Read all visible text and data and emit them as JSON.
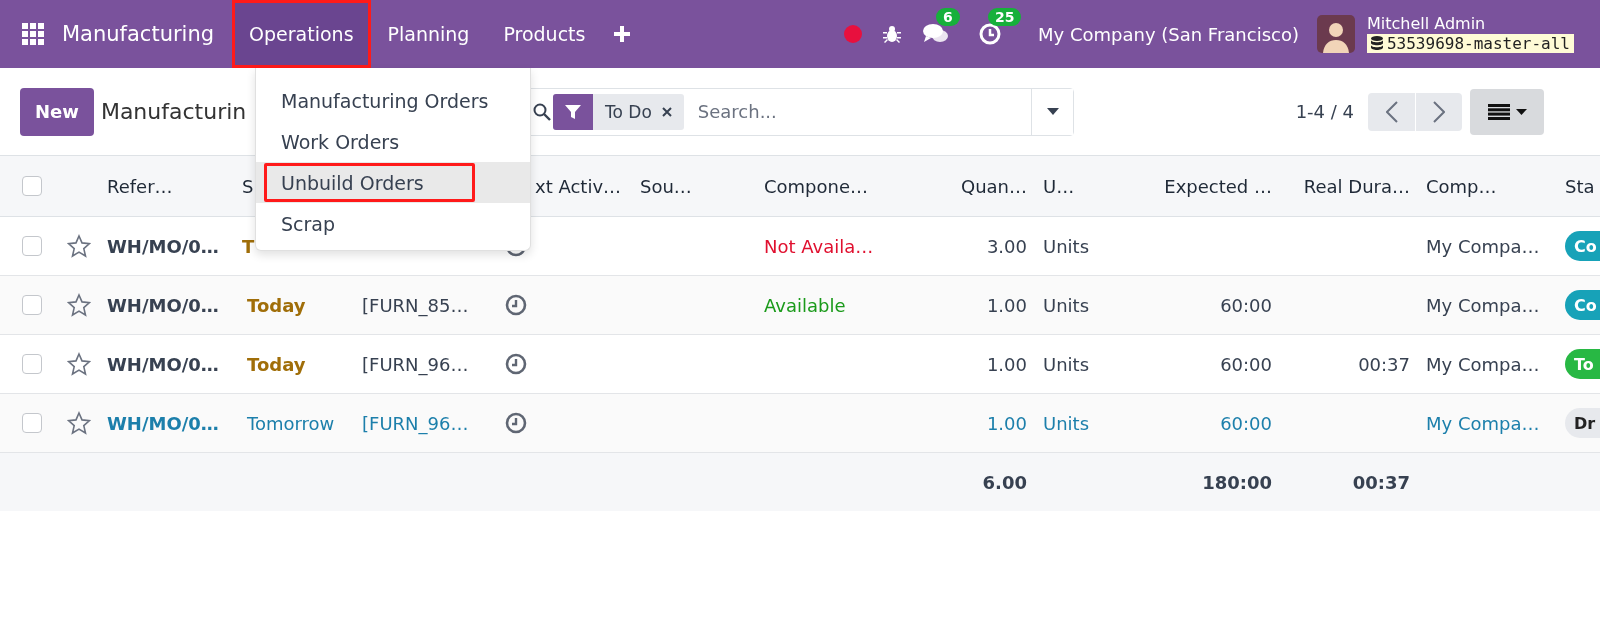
{
  "navbar": {
    "app_name": "Manufacturing",
    "menu": [
      {
        "label": "Operations",
        "selected": true,
        "annotated": true
      },
      {
        "label": "Planning",
        "selected": false,
        "annotated": false
      },
      {
        "label": "Products",
        "selected": false,
        "annotated": false
      }
    ],
    "messages_badge": "6",
    "activities_badge": "25",
    "company": "My Company (San Francisco)",
    "user": "Mitchell Admin",
    "database": "53539698-master-all"
  },
  "dropdown": {
    "items": [
      {
        "label": "Manufacturing Orders",
        "selected": false,
        "annotated": false
      },
      {
        "label": "Work Orders",
        "selected": false,
        "annotated": false
      },
      {
        "label": "Unbuild Orders",
        "selected": true,
        "annotated": true
      },
      {
        "label": "Scrap",
        "selected": false,
        "annotated": false
      }
    ]
  },
  "control_panel": {
    "new_button": "New",
    "breadcrumb": "Manufacturin",
    "facet": "To Do",
    "search": {
      "placeholder": "Search..."
    },
    "pager": "1-4 / 4"
  },
  "table": {
    "select_all_checked": false,
    "columns": [
      "Refer…",
      "S",
      "xt Activ…",
      "Sou…",
      "Compone…",
      "Quan…",
      "U…",
      "Expected …",
      "Real Dura…",
      "Comp…",
      "Sta"
    ],
    "rows": [
      {
        "checked": false,
        "starred": false,
        "future": false,
        "reference": "WH/MO/0…",
        "date": "T",
        "date_emphasis": true,
        "component_status": "Not Availa…",
        "components_available": false,
        "quantity": "3.00",
        "unit": "Units",
        "company": "My Compa…",
        "status": {
          "label": "Co",
          "color": "#17a2b8"
        }
      },
      {
        "checked": false,
        "starred": false,
        "future": false,
        "reference": "WH/MO/0…",
        "date": "Today",
        "date_emphasis": true,
        "product": "[FURN_85…",
        "component_status": "Available",
        "components_available": true,
        "quantity": "1.00",
        "unit": "Units",
        "expected_duration": "60:00",
        "company": "My Compa…",
        "status": {
          "label": "Co",
          "color": "#17a2b8"
        }
      },
      {
        "checked": false,
        "starred": false,
        "future": false,
        "reference": "WH/MO/0…",
        "date": "Today",
        "date_emphasis": true,
        "product": "[FURN_96…",
        "quantity": "1.00",
        "unit": "Units",
        "expected_duration": "60:00",
        "real_duration": "00:37",
        "company": "My Compa…",
        "status": {
          "label": "To",
          "color": "#28b844"
        }
      },
      {
        "checked": false,
        "starred": false,
        "future": true,
        "reference": "WH/MO/0…",
        "date": "Tomorrow",
        "date_emphasis": false,
        "product": "[FURN_96…",
        "quantity": "1.00",
        "unit": "Units",
        "expected_duration": "60:00",
        "company": "My Compa…",
        "status": {
          "label": "Dr",
          "color": "#e7e9ed"
        }
      }
    ],
    "totals": {
      "quantity": "6.00",
      "expected_duration": "180:00",
      "real_duration": "00:37"
    }
  }
}
